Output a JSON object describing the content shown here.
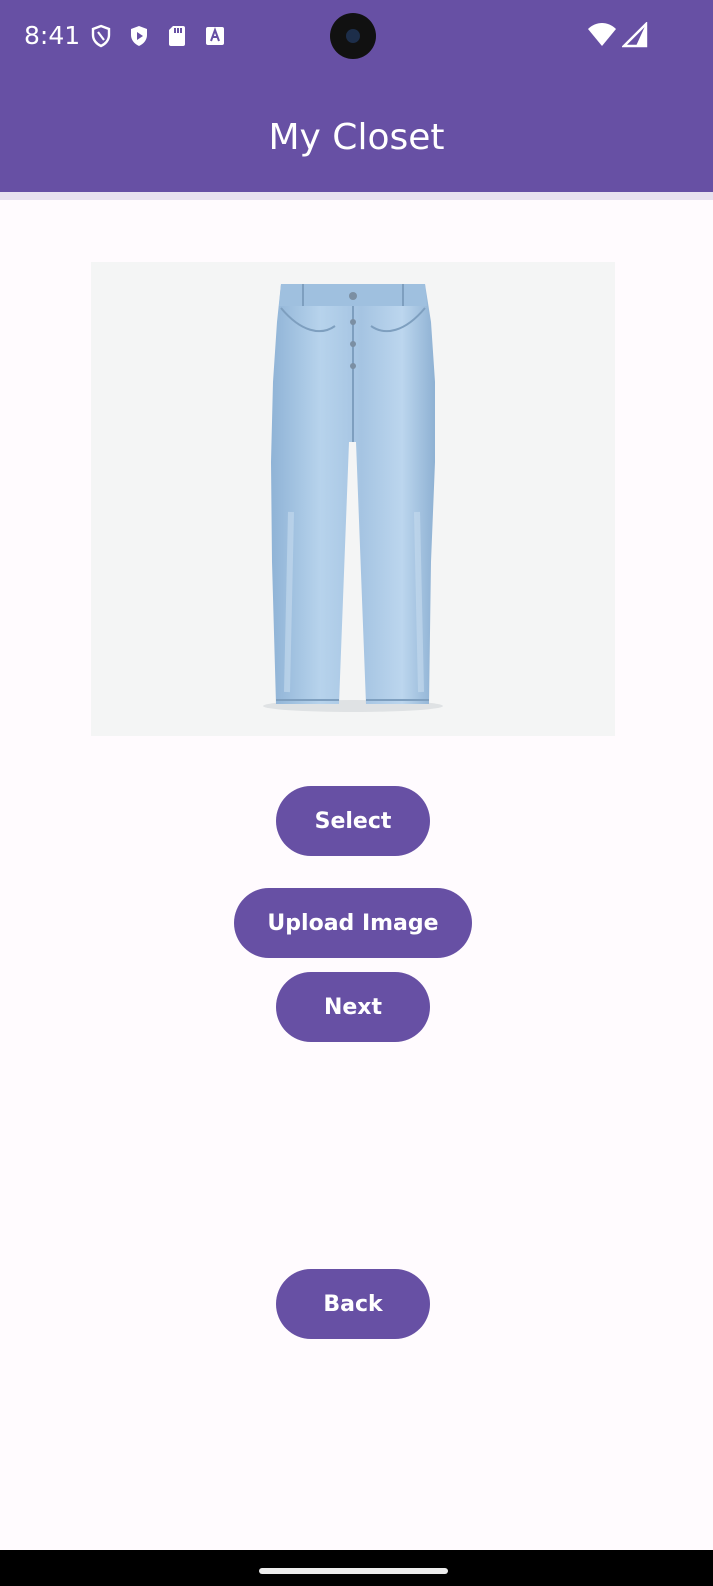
{
  "status_bar": {
    "time": "8:41",
    "left_icons": [
      "shield-icon",
      "play-protect-icon",
      "sd-card-icon",
      "keyboard-a-icon"
    ],
    "right_icons": [
      "wifi-icon",
      "cellular-signal-icon"
    ]
  },
  "app_bar": {
    "title": "My Closet"
  },
  "garment_image": {
    "subject": "light-wash-jeans"
  },
  "buttons": {
    "select": "Select",
    "upload_image": "Upload Image",
    "next": "Next",
    "back": "Back"
  },
  "colors": {
    "primary": "#6750a4",
    "background": "#fffbfe",
    "on_primary": "#ffffff",
    "denim": "#a9c8e6"
  }
}
